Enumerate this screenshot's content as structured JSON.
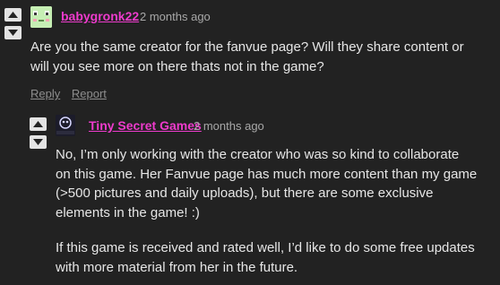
{
  "comments": [
    {
      "author": "babygronk22",
      "date": "2 months ago",
      "avatar_icon": "frog-face-avatar",
      "body": [
        "Are you the same creator for the fanvue page? Will they share content or",
        "will you see more on there thats not in the game?"
      ],
      "actions": {
        "reply": "Reply",
        "report": "Report"
      }
    },
    {
      "author": "Tiny Secret Games",
      "date": "2 months ago",
      "avatar_icon": "tiny-secret-logo-avatar",
      "avatar_text": "TINYSECRET",
      "body": [
        "No, I’m only working with the creator who was so kind to collaborate",
        "on this game. Her Fanvue page has much more content than my game",
        "(>500 pictures and daily uploads), but there are some exclusive",
        "elements in the game! :)"
      ],
      "body2": [
        "If this game is received and rated well, I’d like to do some free updates",
        "with more material from her in the future."
      ]
    }
  ],
  "colors": {
    "background": "#222222",
    "author": "#ee3bcc",
    "muted": "#8d8d8d",
    "text": "#e6e6e6"
  },
  "icons": {
    "upvote": "triangle-up-icon",
    "downvote": "triangle-down-icon"
  }
}
